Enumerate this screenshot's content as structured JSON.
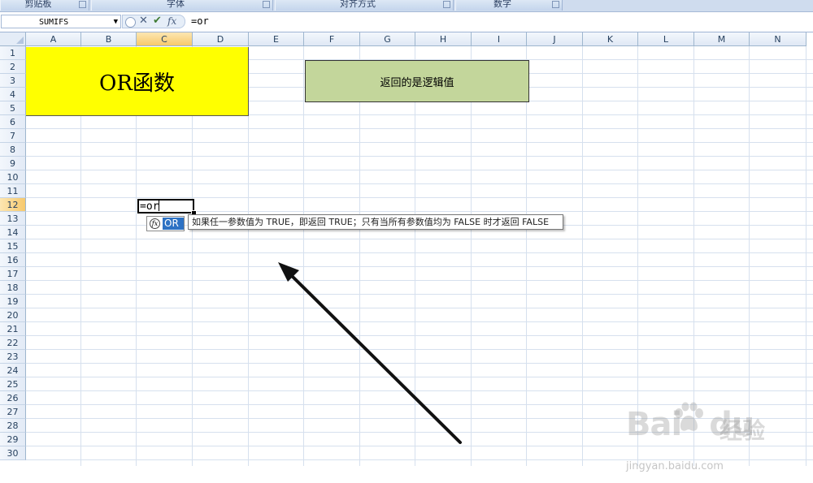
{
  "ribbon": {
    "groups": [
      {
        "label": "剪贴板"
      },
      {
        "label": "字体"
      },
      {
        "label": "对齐方式"
      },
      {
        "label": "数字"
      }
    ]
  },
  "formula_bar": {
    "name_box": "SUMIFS",
    "content": "=or",
    "fx_label": "fx"
  },
  "columns": [
    "A",
    "B",
    "C",
    "D",
    "E",
    "F",
    "G",
    "H",
    "I",
    "J",
    "K",
    "L",
    "M",
    "N"
  ],
  "rows": [
    "1",
    "2",
    "3",
    "4",
    "5",
    "6",
    "7",
    "8",
    "9",
    "10",
    "11",
    "12",
    "13",
    "14",
    "15",
    "16",
    "17",
    "18",
    "19",
    "20",
    "21",
    "22",
    "23",
    "24",
    "25",
    "26",
    "27",
    "28",
    "29",
    "30"
  ],
  "selected_column": "C",
  "selected_row": "12",
  "cells": {
    "title": "OR函数",
    "note": "返回的是逻辑值",
    "active_cell_text": "=or"
  },
  "autocomplete": {
    "option": "OR",
    "tooltip": "如果任一参数值为 TRUE，即返回 TRUE；只有当所有参数值均为 FALSE 时才返回 FALSE"
  },
  "watermark": {
    "brand": "Bai",
    "brand2": "du",
    "cn": "经验",
    "url": "jingyan.baidu.com"
  },
  "colors": {
    "yellow_fill": "#ffff00",
    "green_fill": "#c3d69b",
    "selection_header": "#f7c96c",
    "autocomplete_highlight": "#2d72c4"
  }
}
